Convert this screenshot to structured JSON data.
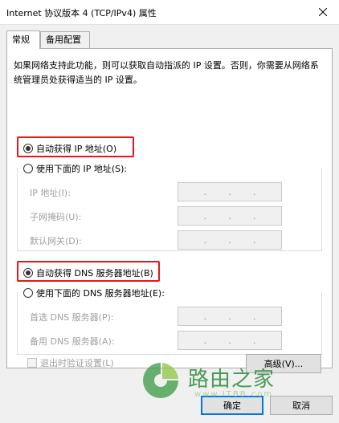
{
  "window": {
    "title": "Internet 协议版本 4 (TCP/IPv4) 属性"
  },
  "tabs": [
    {
      "label": "常规"
    },
    {
      "label": "备用配置"
    }
  ],
  "description": "如果网络支持此功能，则可以获取自动指派的 IP 设置。否则，你需要从网络系统管理员处获得适当的 IP 设置。",
  "ip_section": {
    "auto_label": "自动获得 IP 地址(O)",
    "manual_label": "使用下面的 IP 地址(S):",
    "auto_selected": true,
    "fields": [
      {
        "label": "IP 地址(I):"
      },
      {
        "label": "子网掩码(U):"
      },
      {
        "label": "默认网关(D):"
      }
    ]
  },
  "dns_section": {
    "auto_label": "自动获得 DNS 服务器地址(B)",
    "manual_label": "使用下面的 DNS 服务器地址(E):",
    "auto_selected": true,
    "fields": [
      {
        "label": "首选 DNS 服务器(P):"
      },
      {
        "label": "备用 DNS 服务器(A):"
      }
    ]
  },
  "validate_label": "退出时验证设置(L)",
  "buttons": {
    "advanced": "高级(V)...",
    "ok": "确定",
    "cancel": "取消"
  },
  "watermark": {
    "text": "路由之家",
    "url": "www.ITBB.com"
  },
  "colors": {
    "highlight": "#e8161d",
    "watermark": "#2d8a3a",
    "default_button_border": "#0078d7"
  }
}
